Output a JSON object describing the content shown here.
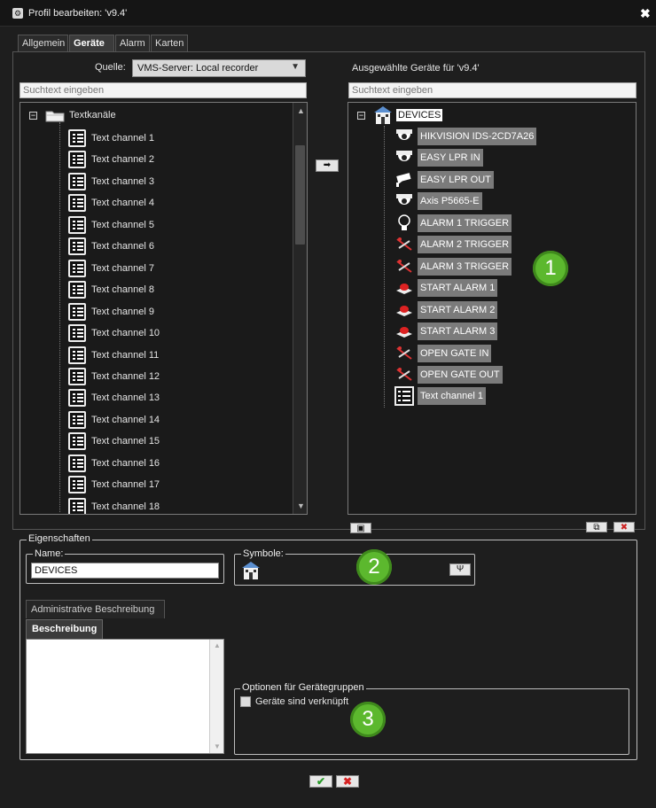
{
  "window": {
    "title": "Profil bearbeiten: 'v9.4'",
    "close_glyph": "✖"
  },
  "tabs": [
    "Allgemein",
    "Geräte",
    "Alarm",
    "Karten"
  ],
  "source": {
    "label": "Quelle:",
    "value": "VMS-Server: Local recorder"
  },
  "left": {
    "search_placeholder": "Suchtext eingeben",
    "root": "Textkanäle",
    "items": [
      "Text channel 1",
      "Text channel 2",
      "Text channel 3",
      "Text channel 4",
      "Text channel 5",
      "Text channel 6",
      "Text channel 7",
      "Text channel 8",
      "Text channel 9",
      "Text channel 10",
      "Text channel 11",
      "Text channel 12",
      "Text channel 13",
      "Text channel 14",
      "Text channel 15",
      "Text channel 16",
      "Text channel 17",
      "Text channel 18"
    ]
  },
  "right": {
    "title": "Ausgewählte Geräte für 'v9.4'",
    "search_placeholder": "Suchtext eingeben",
    "root": "DEVICES",
    "items": [
      {
        "label": "HIKVISION IDS-2CD7A26",
        "icon": "dome-camera-icon"
      },
      {
        "label": "EASY LPR IN",
        "icon": "dome-camera-icon"
      },
      {
        "label": "EASY LPR OUT",
        "icon": "bullet-camera-icon"
      },
      {
        "label": "Axis P5665-E",
        "icon": "dome-camera-icon"
      },
      {
        "label": "ALARM 1 TRIGGER",
        "icon": "lightbulb-icon"
      },
      {
        "label": "ALARM 2 TRIGGER",
        "icon": "disabled-relay-icon"
      },
      {
        "label": "ALARM 3 TRIGGER",
        "icon": "disabled-relay-icon"
      },
      {
        "label": "START ALARM 1",
        "icon": "alarm-button-icon"
      },
      {
        "label": "START ALARM 2",
        "icon": "alarm-button-icon"
      },
      {
        "label": "START ALARM 3",
        "icon": "alarm-button-icon"
      },
      {
        "label": "OPEN GATE IN",
        "icon": "disabled-relay-icon"
      },
      {
        "label": "OPEN GATE OUT",
        "icon": "disabled-relay-icon"
      },
      {
        "label": "Text channel 1",
        "icon": "text-channel-icon"
      }
    ]
  },
  "properties": {
    "title": "Eigenschaften",
    "name_label": "Name:",
    "name_value": "DEVICES",
    "symbol_label": "Symbole:",
    "admin_desc_tab": "Administrative Beschreibung",
    "desc_tab": "Beschreibung",
    "options_title": "Optionen für Gerätegruppen",
    "linked_label": "Geräte sind verknüpft"
  },
  "badges": [
    "1",
    "2",
    "3"
  ],
  "buttons": {
    "ok": "✔",
    "cancel": "✖",
    "move": "➡"
  }
}
